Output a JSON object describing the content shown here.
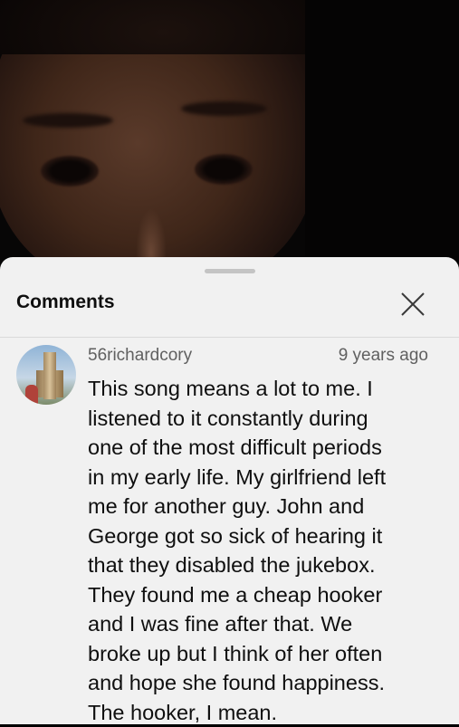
{
  "panel": {
    "title": "Comments",
    "close_icon": "close-icon"
  },
  "comments": [
    {
      "author": "56richardcory",
      "time": "9 years ago",
      "text": "This song means a lot to me.  I\nlistened to it constantly during\none of the most difficult periods\nin my early life.  My girlfriend left\nme for another guy.  John and\nGeorge got so sick of hearing it\nthat they disabled the jukebox.\nThey found me a cheap hooker\nand I was fine after that.  We\nbroke up but I think of her often\nand hope she found happiness.\nThe hooker, I mean."
    }
  ],
  "colors": {
    "sheet_bg": "#f1f1f1",
    "text": "#0f0f0f",
    "secondary_text": "#606060"
  }
}
